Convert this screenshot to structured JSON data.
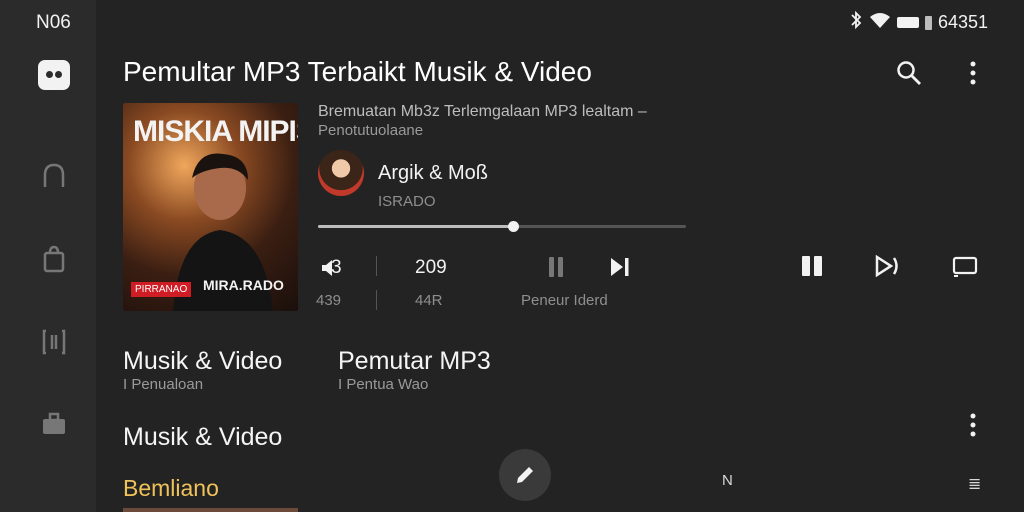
{
  "status_bar": {
    "time": "N06",
    "right_text": "64351"
  },
  "app": {
    "title": "Pemultar MP3 Terbaikt Musik & Video"
  },
  "now_playing": {
    "cover_title": "MISKIA MIPIS",
    "cover_tag": "PIRRANAO",
    "cover_subtitle": "MIRA.RADO",
    "track_title": "Bremuatan Mb3z Terlemgalaan MP3 lealtam –",
    "track_subtitle": "Penotutuolaane",
    "artist": "Argik & Moß",
    "artist_sub": "ISRADO",
    "progress_fraction": 0.53
  },
  "controls": {
    "volume_value": "3",
    "volume_sub": "439",
    "count_value": "209",
    "count_sub": "44R",
    "player_sub": "Peneur Iderd"
  },
  "sections": [
    {
      "title": "Musik & Video",
      "sub": "I Penualoan"
    },
    {
      "title": "Pemutar MP3",
      "sub": "I Pentua Wao"
    }
  ],
  "section_heading": "Musik & Video",
  "featured_title": "Bemliano",
  "bottom": {
    "n_label": "N",
    "right_label": "≣"
  },
  "colors": {
    "background": "#232323",
    "rail": "#2b2b2b",
    "accent_yellow": "#f0c25a",
    "cover_tag": "#d01c24"
  }
}
